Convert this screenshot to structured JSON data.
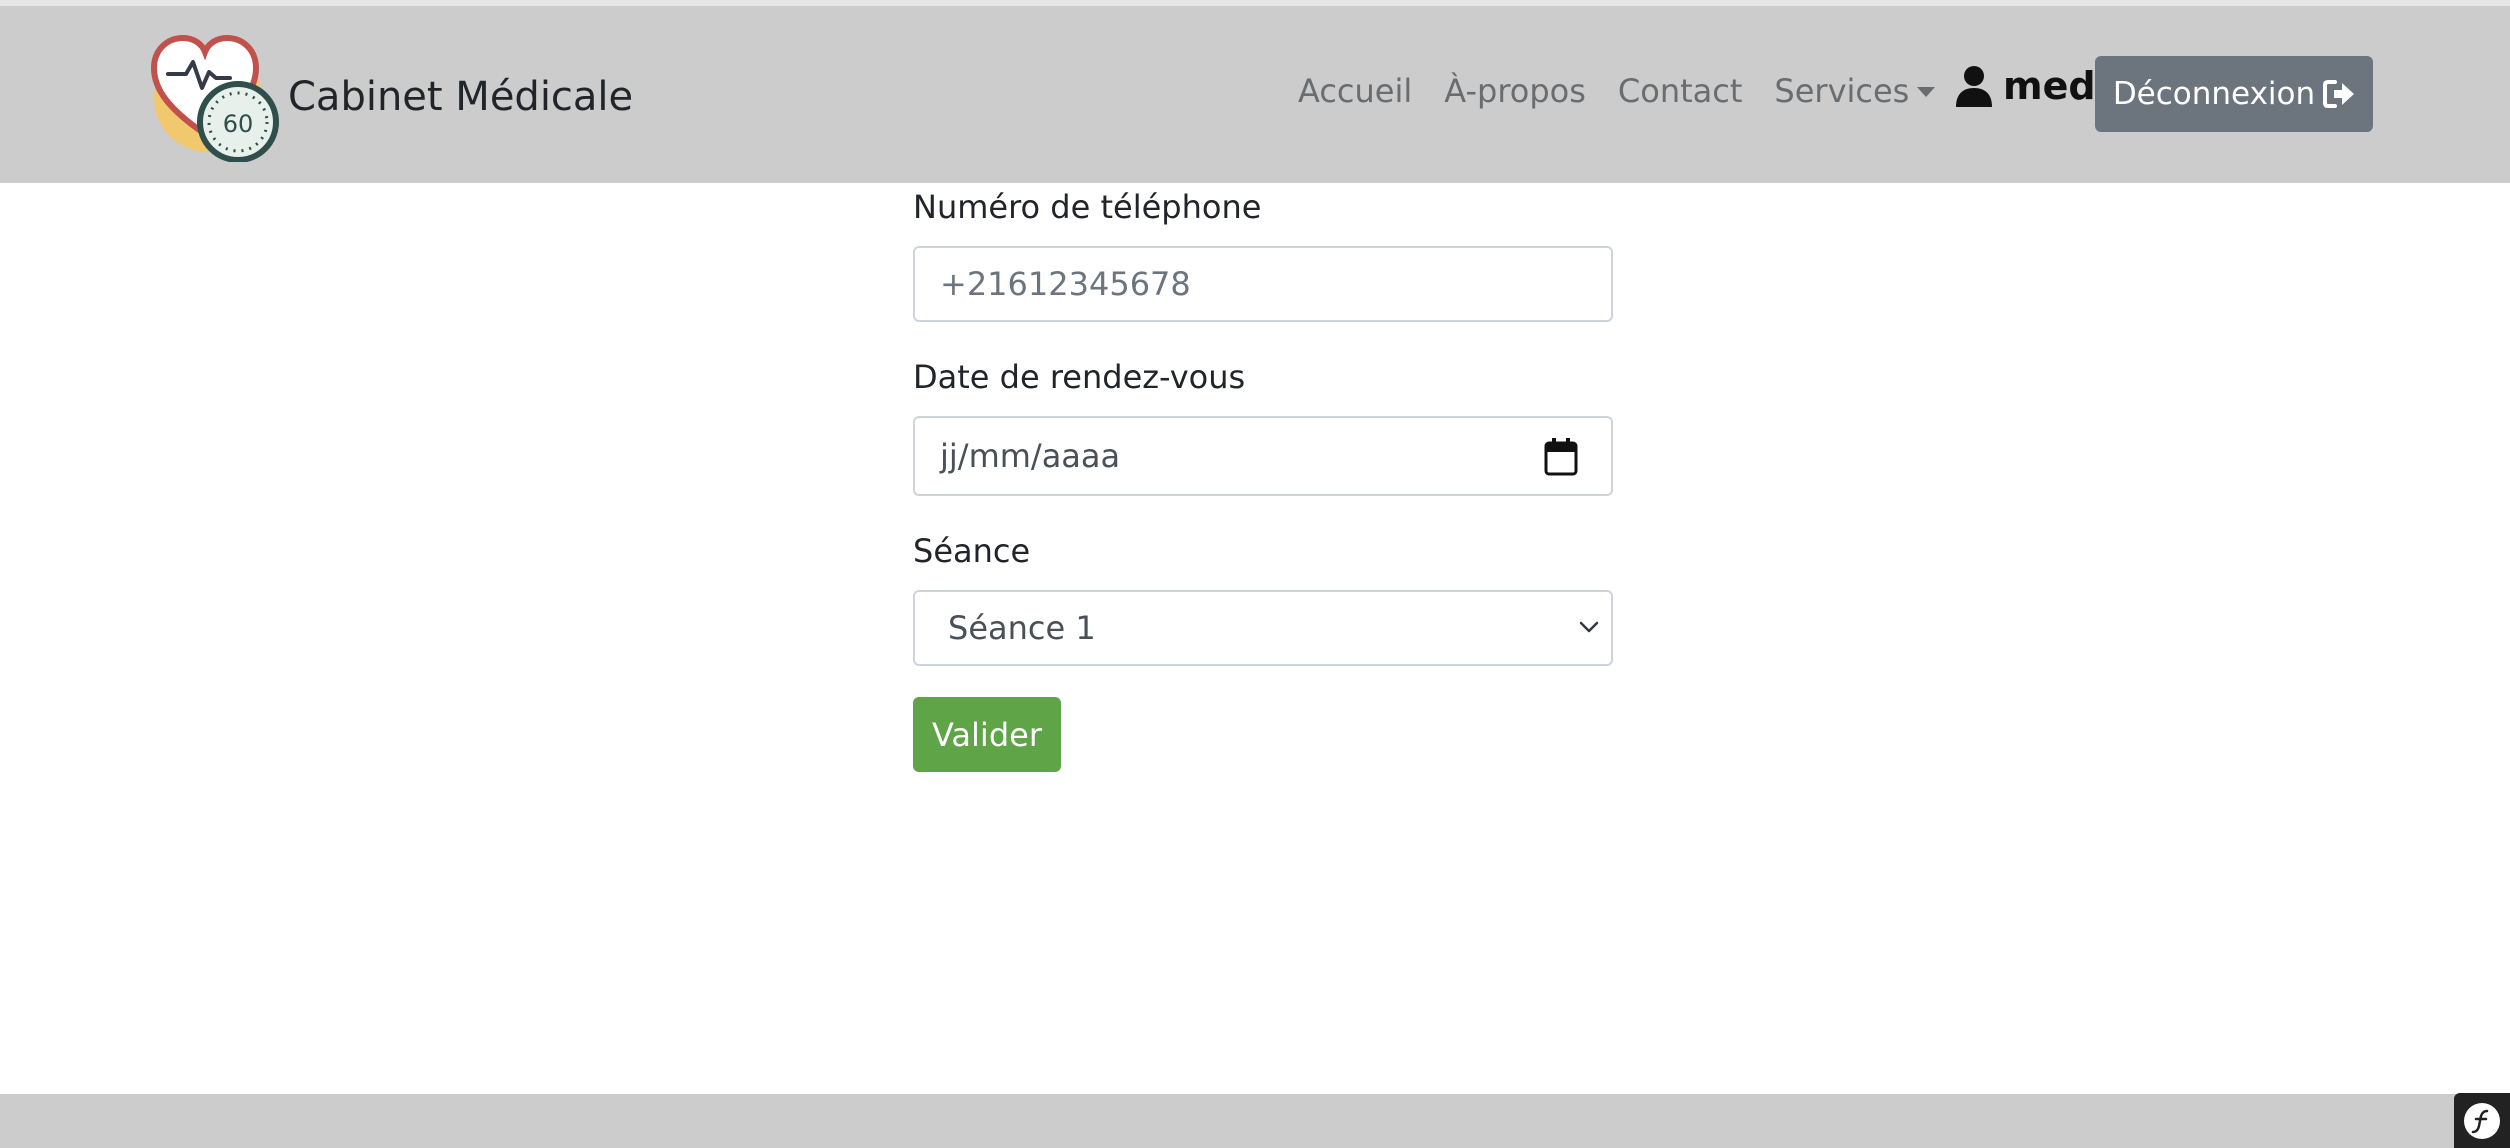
{
  "navbar": {
    "brand_name": "Cabinet Médicale",
    "logo_text": "60",
    "links": [
      {
        "label": "Accueil"
      },
      {
        "label": "À-propos"
      },
      {
        "label": "Contact"
      },
      {
        "label": "Services"
      }
    ],
    "user_name": "med",
    "logout_label": "Déconnexion",
    "background": "#cccccc"
  },
  "form": {
    "phone_label": "Numéro de téléphone",
    "phone_placeholder": "+21612345678",
    "date_label": "Date de rendez-vous",
    "date_placeholder": "jj/mm/aaaa",
    "session_label": "Séance",
    "session_selected": "Séance 1",
    "submit_label": "Valider"
  },
  "colors": {
    "submit": "#5fa447",
    "logout": "#6c757d",
    "footer": "#cccccc"
  },
  "icons": {
    "user": "user-icon",
    "logout": "sign-out-icon",
    "calendar": "calendar-icon",
    "select": "chevron-down-icon",
    "debug": "symfony-icon"
  }
}
